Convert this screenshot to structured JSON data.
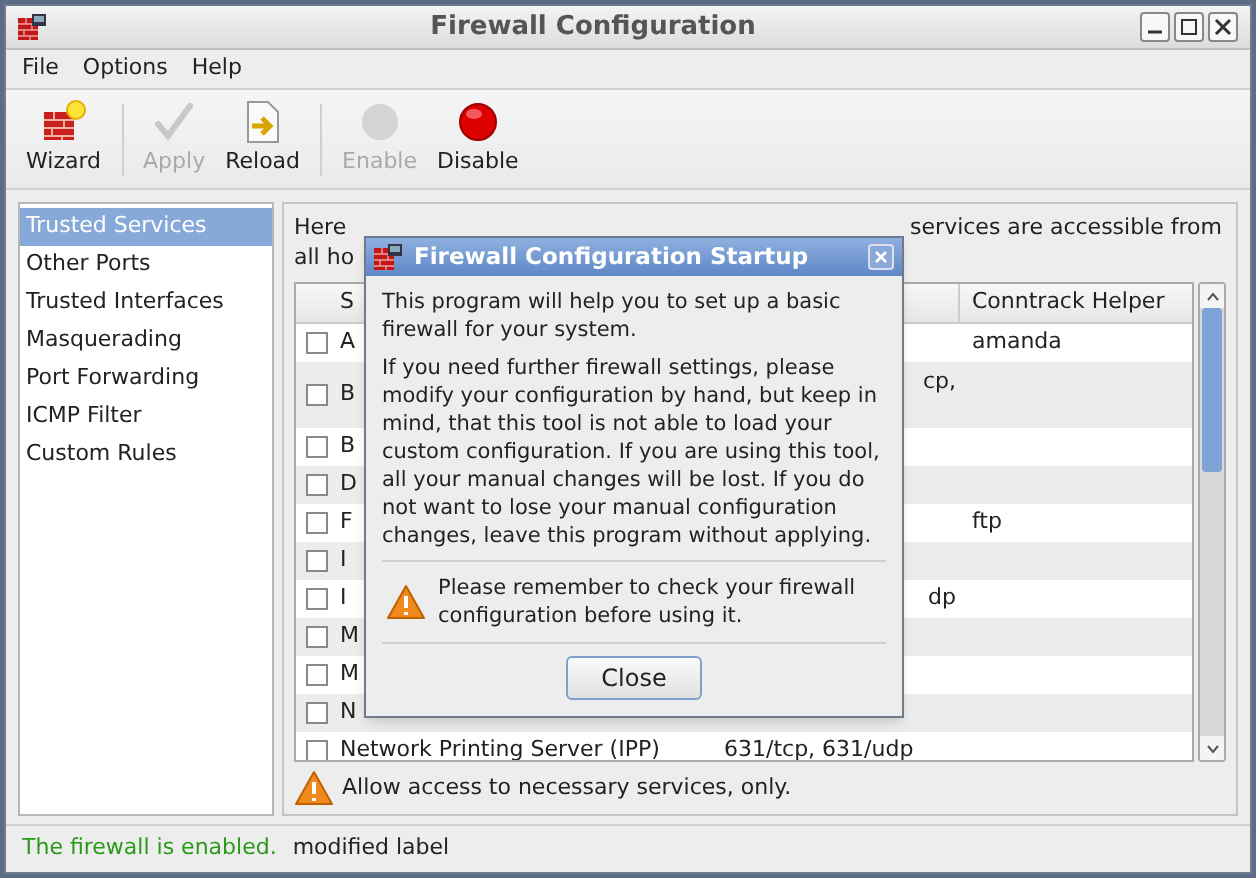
{
  "window": {
    "title": "Firewall Configuration"
  },
  "menu": [
    "File",
    "Options",
    "Help"
  ],
  "toolbar": [
    {
      "kind": "wizard",
      "label": "Wizard",
      "disabled": false
    },
    {
      "kind": "apply",
      "label": "Apply",
      "disabled": true
    },
    {
      "kind": "reload",
      "label": "Reload",
      "disabled": false
    },
    {
      "kind": "enable",
      "label": "Enable",
      "disabled": true
    },
    {
      "kind": "disable",
      "label": "Disable",
      "disabled": false
    }
  ],
  "sidebar": {
    "items": [
      {
        "label": "Trusted Services",
        "selected": true
      },
      {
        "label": "Other Ports",
        "selected": false
      },
      {
        "label": "Trusted Interfaces",
        "selected": false
      },
      {
        "label": "Masquerading",
        "selected": false
      },
      {
        "label": "Port Forwarding",
        "selected": false
      },
      {
        "label": "ICMP Filter",
        "selected": false
      },
      {
        "label": "Custom Rules",
        "selected": false
      }
    ]
  },
  "description": {
    "line_1_start": "Here",
    "line_1_end": "services are accessible from",
    "line_2": "all ho"
  },
  "table": {
    "columns": [
      "S",
      "Conntrack Helper"
    ],
    "rows": [
      {
        "checked": false,
        "name": "A",
        "port": "",
        "helper": "amanda"
      },
      {
        "checked": false,
        "name": "B",
        "port": "cp,",
        "helper": ""
      },
      {
        "checked": false,
        "name": "B",
        "port": "",
        "helper": ""
      },
      {
        "checked": false,
        "name": "D",
        "port": "",
        "helper": ""
      },
      {
        "checked": false,
        "name": "F",
        "port": "",
        "helper": "ftp"
      },
      {
        "checked": false,
        "name": "I",
        "port": "",
        "helper": ""
      },
      {
        "checked": false,
        "name": "I",
        "port": "dp",
        "helper": ""
      },
      {
        "checked": false,
        "name": "M",
        "port": "",
        "helper": ""
      },
      {
        "checked": false,
        "name": "M",
        "port": "",
        "helper": ""
      },
      {
        "checked": false,
        "name": "N",
        "port": "",
        "helper": ""
      },
      {
        "checked": false,
        "name": "Network Printing Server (IPP)",
        "port": "631/tcp, 631/udp",
        "helper": ""
      }
    ]
  },
  "note": "Allow access to necessary services, only.",
  "dialog": {
    "title": "Firewall Configuration Startup",
    "paragraphs": [
      "This program will help you to set up a basic firewall for your system.",
      "If you need further firewall settings, please modify your configuration by hand, but keep in mind, that this tool is not able to load your custom configuration. If you are using this tool, all your manual changes will be lost. If you do not want to lose your manual configuration changes, leave this program without applying."
    ],
    "warning": "Please remember to check your firewall configuration before using it.",
    "button": "Close"
  },
  "status_bar": {
    "state": "The firewall is enabled.",
    "label": "modified label"
  }
}
